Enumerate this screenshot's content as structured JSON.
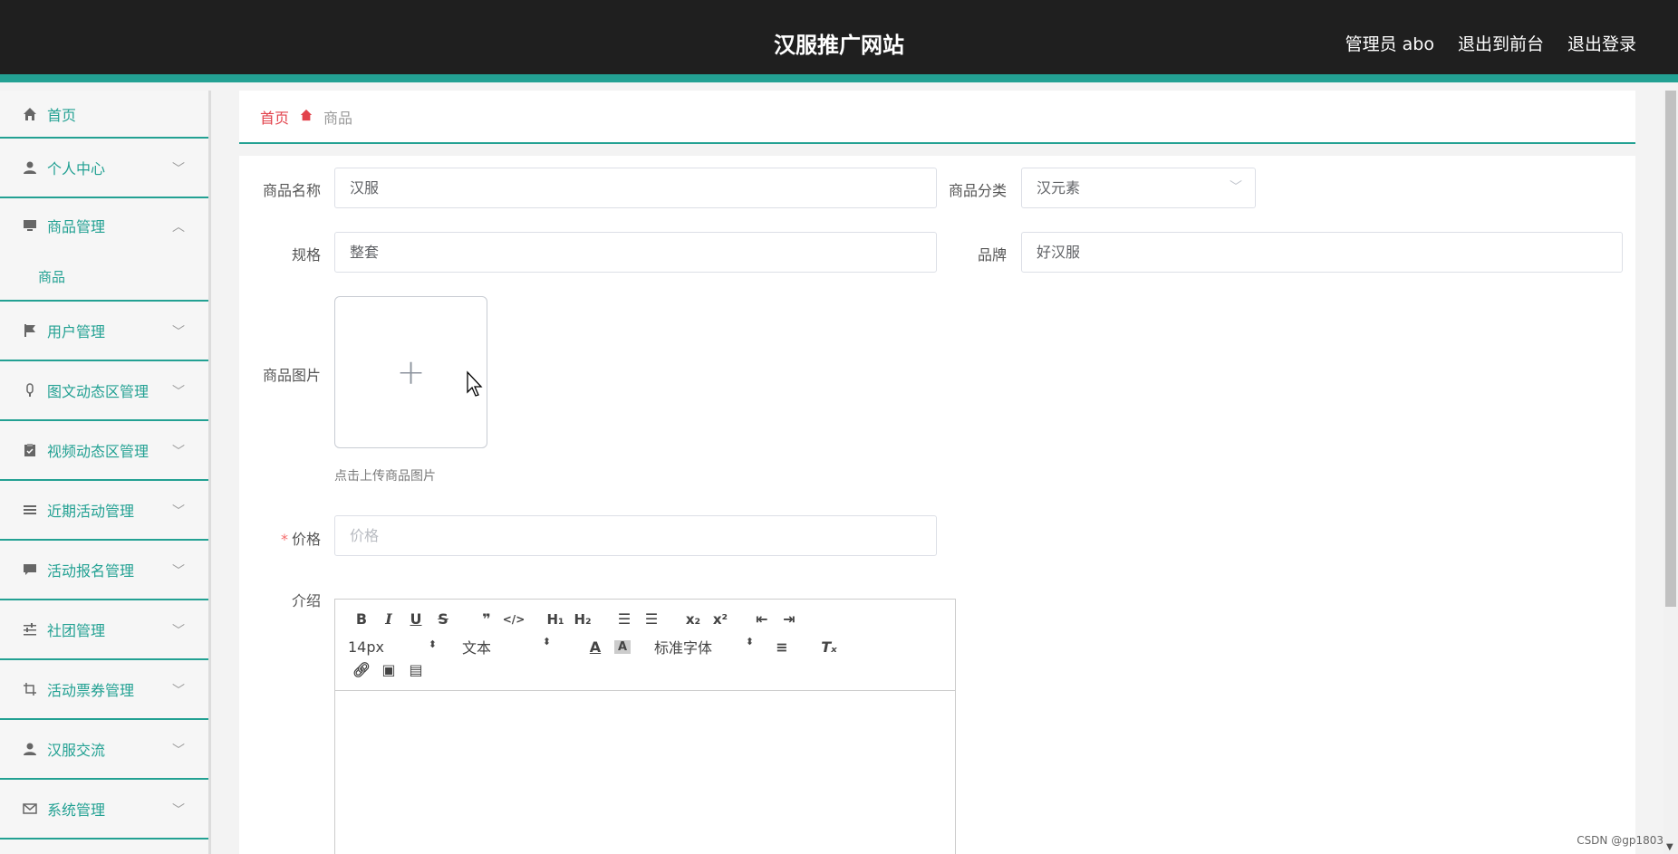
{
  "header": {
    "title": "汉服推广网站",
    "admin": "管理员 abo",
    "to_front": "退出到前台",
    "logout": "退出登录"
  },
  "sidebar": {
    "items": [
      {
        "label": "首页",
        "icon": "home-icon"
      },
      {
        "label": "个人中心",
        "icon": "user-icon"
      },
      {
        "label": "商品管理",
        "icon": "goods-icon",
        "sub": [
          "商品"
        ]
      },
      {
        "label": "用户管理",
        "icon": "flag-icon"
      },
      {
        "label": "图文动态区管理",
        "icon": "mic-icon"
      },
      {
        "label": "视频动态区管理",
        "icon": "clipboard-icon"
      },
      {
        "label": "近期活动管理",
        "icon": "list-icon"
      },
      {
        "label": "活动报名管理",
        "icon": "chat-icon"
      },
      {
        "label": "社团管理",
        "icon": "sliders-icon"
      },
      {
        "label": "活动票券管理",
        "icon": "crop-icon"
      },
      {
        "label": "汉服交流",
        "icon": "user-icon"
      },
      {
        "label": "系统管理",
        "icon": "mail-icon"
      }
    ]
  },
  "breadcrumb": {
    "home": "首页",
    "current": "商品"
  },
  "form": {
    "name_label": "商品名称",
    "name_value": "汉服",
    "category_label": "商品分类",
    "category_value": "汉元素",
    "spec_label": "规格",
    "spec_value": "整套",
    "brand_label": "品牌",
    "brand_value": "好汉服",
    "image_label": "商品图片",
    "image_tip": "点击上传商品图片",
    "price_label": "价格",
    "price_placeholder": "价格",
    "intro_label": "介绍"
  },
  "editor": {
    "font_size": "14px",
    "block_type": "文本",
    "font_family": "标准字体"
  },
  "watermark": "CSDN @gp1803"
}
